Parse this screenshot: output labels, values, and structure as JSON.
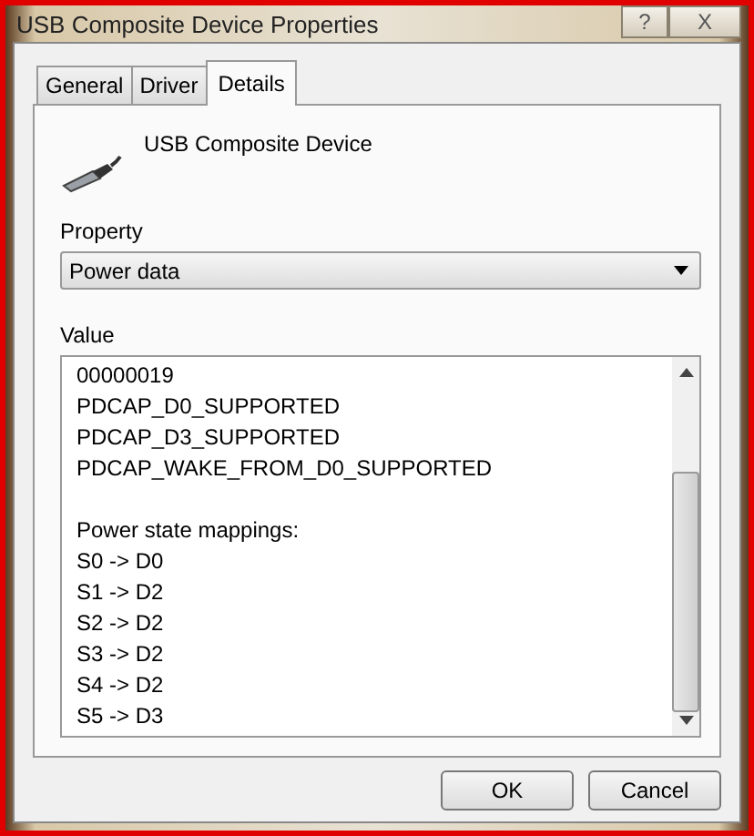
{
  "window": {
    "title": "USB Composite Device Properties",
    "title_buttons": [
      "?",
      "X"
    ]
  },
  "tabs": [
    {
      "label": "General",
      "selected": false
    },
    {
      "label": "Driver",
      "selected": false
    },
    {
      "label": "Details",
      "selected": true
    }
  ],
  "device": {
    "name": "USB Composite Device"
  },
  "property": {
    "label": "Property",
    "value": "Power data"
  },
  "value": {
    "label": "Value",
    "groups": [
      [
        "00000019",
        "PDCAP_D0_SUPPORTED",
        "PDCAP_D3_SUPPORTED",
        "PDCAP_WAKE_FROM_D0_SUPPORTED"
      ],
      [
        "Power state mappings:",
        "S0 -> D0",
        "S1 -> D2",
        "S2 -> D2",
        "S3 -> D2",
        "S4 -> D2",
        "S5 -> D3"
      ]
    ]
  },
  "buttons": [
    "OK",
    "Cancel"
  ]
}
